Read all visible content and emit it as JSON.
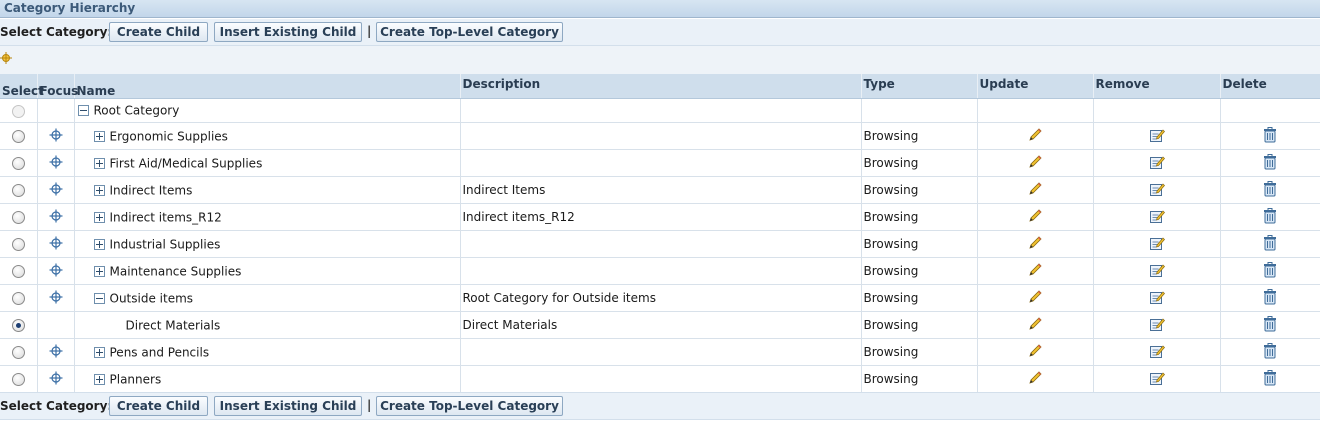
{
  "region": {
    "title": "Category Hierarchy"
  },
  "toolbar": {
    "label": "Select Category:",
    "create_child": "Create Child",
    "insert_existing": "Insert Existing Child",
    "separator": "|",
    "create_top": "Create Top-Level Category"
  },
  "columns": {
    "select": "Select",
    "focus": "Focus",
    "name": "Name",
    "description": "Description",
    "type": "Type",
    "update": "Update",
    "remove": "Remove",
    "delete": "Delete"
  },
  "icons": {
    "focus": "focus-crosshair-icon",
    "expand": "expand-plus-icon",
    "collapse": "collapse-minus-icon",
    "update": "pencil-icon",
    "remove": "edit-remove-icon",
    "delete": "trash-icon"
  },
  "rows": [
    {
      "name": "Root Category",
      "description": "",
      "type": "",
      "expand": "minus",
      "indent": 0,
      "selected": false,
      "disabled": true,
      "focus": false,
      "actions": false
    },
    {
      "name": "Ergonomic Supplies",
      "description": "",
      "type": "Browsing",
      "expand": "plus",
      "indent": 1,
      "selected": false,
      "disabled": false,
      "focus": true,
      "actions": true
    },
    {
      "name": "First Aid/Medical Supplies",
      "description": "",
      "type": "Browsing",
      "expand": "plus",
      "indent": 1,
      "selected": false,
      "disabled": false,
      "focus": true,
      "actions": true
    },
    {
      "name": "Indirect Items",
      "description": "Indirect Items",
      "type": "Browsing",
      "expand": "plus",
      "indent": 1,
      "selected": false,
      "disabled": false,
      "focus": true,
      "actions": true
    },
    {
      "name": "Indirect items_R12",
      "description": "Indirect items_R12",
      "type": "Browsing",
      "expand": "plus",
      "indent": 1,
      "selected": false,
      "disabled": false,
      "focus": true,
      "actions": true
    },
    {
      "name": "Industrial Supplies",
      "description": "",
      "type": "Browsing",
      "expand": "plus",
      "indent": 1,
      "selected": false,
      "disabled": false,
      "focus": true,
      "actions": true
    },
    {
      "name": "Maintenance Supplies",
      "description": "",
      "type": "Browsing",
      "expand": "plus",
      "indent": 1,
      "selected": false,
      "disabled": false,
      "focus": true,
      "actions": true
    },
    {
      "name": "Outside items",
      "description": "Root Category for Outside items",
      "type": "Browsing",
      "expand": "minus",
      "indent": 1,
      "selected": false,
      "disabled": false,
      "focus": true,
      "actions": true
    },
    {
      "name": "Direct Materials",
      "description": "Direct Materials",
      "type": "Browsing",
      "expand": "none",
      "indent": 2,
      "selected": true,
      "disabled": false,
      "focus": false,
      "actions": true
    },
    {
      "name": "Pens and Pencils",
      "description": "",
      "type": "Browsing",
      "expand": "plus",
      "indent": 1,
      "selected": false,
      "disabled": false,
      "focus": true,
      "actions": true
    },
    {
      "name": "Planners",
      "description": "",
      "type": "Browsing",
      "expand": "plus",
      "indent": 1,
      "selected": false,
      "disabled": false,
      "focus": true,
      "actions": true
    }
  ],
  "colors": {
    "header_bg": "#cfdeec",
    "toolbar_bg": "#eaf1f8",
    "title_text": "#3c5a79"
  }
}
